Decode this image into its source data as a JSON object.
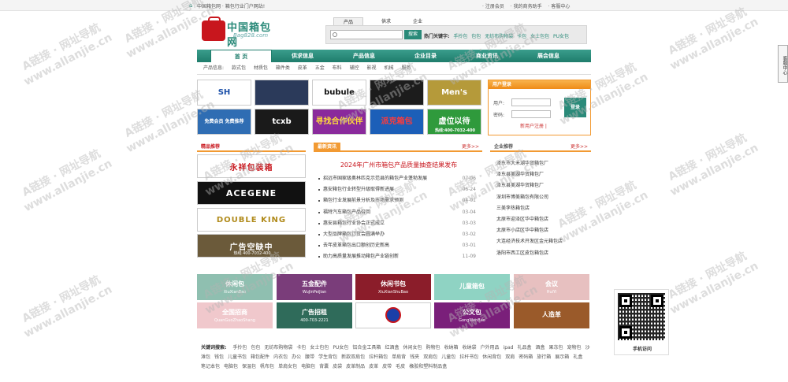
{
  "topbar": {
    "left": "中国箱包网 · 箱包行业门户网站!",
    "links": [
      "· 注册会员",
      "· 我的商务助手",
      "· 客服中心"
    ]
  },
  "logo": {
    "title": "中国箱包网",
    "sub": "Bag828.com"
  },
  "search": {
    "tabs": [
      "产品",
      "供求",
      "企业"
    ],
    "placeholder": "",
    "button": "搜索",
    "hot_label": "热门关键字:",
    "hot": [
      "手拎包",
      "包包",
      "无纺布购物袋",
      "卡包",
      "女士包包",
      "PU女包"
    ]
  },
  "nav": [
    "首 页",
    "供求信息",
    "产品信息",
    "企业目录",
    "商业资讯",
    "展会信息"
  ],
  "subnav": [
    "产品信息:",
    "款式包",
    "材质包",
    "箱件类",
    "皮革",
    "五金",
    "布料",
    "辅控",
    "影视",
    "机械",
    "服务"
  ],
  "logo_tiles": [
    {
      "text": "SH",
      "bg": "#ffffff",
      "color": "#1a4fa8"
    },
    {
      "text": "",
      "bg": "#2b3a5a",
      "color": "#fff"
    },
    {
      "text": "bubule",
      "bg": "#ffffff",
      "color": "#111"
    },
    {
      "text": "",
      "bg": "#1c1c1c",
      "color": "#fff"
    },
    {
      "text": "Men's",
      "bg": "#b59a3a",
      "color": "#fff"
    },
    {
      "text": "免费会员 免费推荐",
      "bg": "#2f6db3",
      "color": "#fff"
    },
    {
      "text": "tcxb",
      "bg": "#1a1a1a",
      "color": "#fff"
    },
    {
      "text": "寻找合作伙伴",
      "bg": "#8a2a9c",
      "color": "#ffde3a"
    },
    {
      "text": "派克箱包",
      "bg": "#1c5fb8",
      "color": "#ff3b3b"
    },
    {
      "text": "虚位以待",
      "bg": "#2f9a3c",
      "color": "#fff"
    }
  ],
  "tile_phone": "热线:400-7032-400",
  "login": {
    "title": "用户登录",
    "user_label": "用户:",
    "pass_label": "密码:",
    "button": "登录",
    "links": "新用户注册 |"
  },
  "featured": {
    "title": "精品推荐",
    "ads": [
      {
        "text": "永祥包装箱",
        "bg": "#fff",
        "color": "#c8161d"
      },
      {
        "text": "ACEGENE",
        "bg": "#111",
        "color": "#fff"
      },
      {
        "text": "DOUBLE KING",
        "bg": "#fff",
        "color": "#b08a1a"
      },
      {
        "text": "广告空缺中",
        "bg": "#6b5a3a",
        "color": "#fff"
      }
    ],
    "ad_phone": "热线 400-7032-400"
  },
  "news": {
    "title": "最新资讯",
    "more": "更多>>",
    "headline": "2024年广州市箱包产品质量抽查结果发布",
    "items": [
      {
        "t": "招远市国家级奥林匹克示范县的箱包产业蓬勃发展",
        "d": "07-06"
      },
      {
        "t": "惠安箱包行业转型升级取得新进展",
        "d": "06-24"
      },
      {
        "t": "箱包行业发展前景分析及市场需求预测",
        "d": "04-01"
      },
      {
        "t": "福特汽车箱包产品召回",
        "d": "03-04"
      },
      {
        "t": "惠安县箱包行业协会正式成立",
        "d": "03-03"
      },
      {
        "t": "大型品牌箱包订货会圆满举办",
        "d": "03-02"
      },
      {
        "t": "去年皮革箱包出口额创历史新高",
        "d": "03-01"
      },
      {
        "t": "助力高质量发展推动箱包产业链创新",
        "d": "11-09"
      }
    ]
  },
  "companies": {
    "title": "企业推荐",
    "more": "更多>>",
    "items": [
      "泽东市大禾湖华贸箱包厂",
      "泽东县美湖华贸箱包厂",
      "泽东县美湖华贸箱包厂",
      "深圳市博美箱包有限公司",
      "三美李热箱包店",
      "太原市迎泽区华中箱包店",
      "太原市小店区华中箱包店",
      "大连经济技术开发区金元箱包店",
      "洛阳市西工区皮包箱包店"
    ]
  },
  "categories": [
    {
      "text": "休闲包",
      "sub": "XiuXianBao",
      "bg": "#8fbfb0"
    },
    {
      "text": "五金配件",
      "sub": "WuJinPeiJian",
      "bg": "#7a3d7a"
    },
    {
      "text": "休闲书包",
      "sub": "XiuXianShuBao",
      "bg": "#8b1d2a"
    },
    {
      "text": "儿童箱包",
      "sub": "",
      "bg": "#8fd3c3"
    },
    {
      "text": "会议",
      "sub": "HuiYi",
      "bg": "#e7c0c0"
    },
    {
      "text": "全国招商",
      "sub": "QuanGuoZhaoShang",
      "bg": "#f0c8cc"
    },
    {
      "text": "广告招租",
      "sub": "400-703-2221",
      "bg": "#2f6b5a"
    },
    {
      "text": "",
      "sub": "",
      "bg": "#ffffff"
    },
    {
      "text": "公文包",
      "sub": "GongWenBao",
      "bg": "#7a1f7a"
    },
    {
      "text": "人造革",
      "sub": "",
      "bg": "#9a5a2a"
    }
  ],
  "keywords": {
    "label": "关键词搜索:",
    "items": [
      "手拎包",
      "包包",
      "无纺布购物袋",
      "卡包",
      "女士包包",
      "PU女包",
      "铝合金工具箱",
      "红酒盒",
      "休闲女包",
      "购物包",
      "收纳箱",
      "收纳袋",
      "户外用品",
      "ipad",
      "礼品盒",
      "酒盒",
      "果冻包",
      "宠物包",
      "沙滩包",
      "钱包",
      "儿童书包",
      "箱包配件",
      "内衣包",
      "办公",
      "腰带",
      "学生背包",
      "新款双肩包",
      "拉杆箱包",
      "单肩背",
      "钱夹",
      "双肩包",
      "儿童包",
      "拉杆书包",
      "休闲背包",
      "双肩",
      "密码箱",
      "旅行箱",
      "展示箱",
      "礼盒",
      "笔记本包",
      "电脑包",
      "保温包",
      "帆布包",
      "单肩女包",
      "电脑包",
      "背囊",
      "皮袋",
      "皮革制品",
      "皮革",
      "皮带",
      "毛皮",
      "橡胶和塑料制品盒"
    ]
  },
  "qr_label": "手机访问",
  "side_label": "客服中心",
  "watermark": [
    "A链接 · 网址导航",
    "www.allanjie.cn"
  ]
}
